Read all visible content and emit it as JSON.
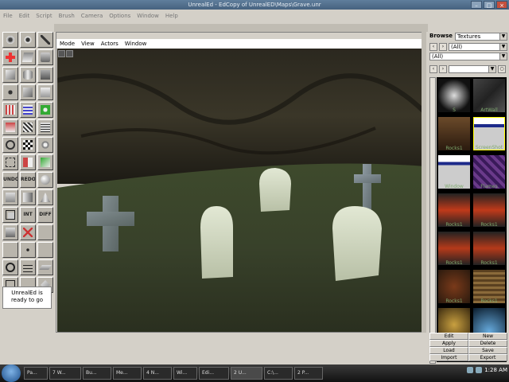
{
  "window": {
    "title": "UnrealEd - EdCopy of UnrealED\\Maps\\Grave.unr"
  },
  "menubar": {
    "items": [
      "File",
      "Edit",
      "Script",
      "Brush",
      "Camera",
      "Options",
      "Window",
      "Help"
    ]
  },
  "toolbar": {
    "tool_labels": {
      "undo": "UNDO",
      "redo": "REDO",
      "int": "INT",
      "diff": "DIFF"
    },
    "status_text": "UnrealEd is ready to go"
  },
  "viewport": {
    "menu": [
      "Mode",
      "View",
      "Actors",
      "Window"
    ]
  },
  "browser": {
    "title": "Browse",
    "type_select": "Textures",
    "package_select": "(All)",
    "group_select": "(All)",
    "thumbnails": [
      {
        "label": "S"
      },
      {
        "label": "ArtWall"
      },
      {
        "label": "Rocks1"
      },
      {
        "label": "ScreenShot"
      },
      {
        "label": "Window"
      },
      {
        "label": "Flames"
      },
      {
        "label": "Rocks1"
      },
      {
        "label": "Rocks1"
      },
      {
        "label": "Rocks1"
      },
      {
        "label": "Rocks1"
      },
      {
        "label": "Rocks1"
      },
      {
        "label": "Rocks1"
      },
      {
        "label": ""
      },
      {
        "label": ""
      }
    ],
    "buttons": [
      {
        "label": "Edit"
      },
      {
        "label": "New"
      },
      {
        "label": "Apply"
      },
      {
        "label": "Delete"
      },
      {
        "label": "Load"
      },
      {
        "label": "Save"
      },
      {
        "label": "Import"
      },
      {
        "label": "Export"
      }
    ]
  },
  "taskbar": {
    "tasks": [
      {
        "label": "Pa..."
      },
      {
        "label": "7 W..."
      },
      {
        "label": "Bu..."
      },
      {
        "label": "Me..."
      },
      {
        "label": "4 N..."
      },
      {
        "label": "Wi..."
      },
      {
        "label": "Edi..."
      },
      {
        "label": "2 U..."
      },
      {
        "label": "C:\\..."
      },
      {
        "label": "2 P..."
      }
    ],
    "clock": "1:28 AM"
  }
}
